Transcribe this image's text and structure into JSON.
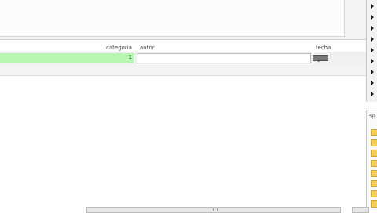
{
  "columns": {
    "categoria": "categoria",
    "autor": "autor",
    "fecha": "fecha"
  },
  "row": {
    "categoria_value": "1",
    "autor_value": ""
  },
  "right_panel": {
    "tab_label": "Sp"
  },
  "colors": {
    "selected_cell": "#b6f5b2",
    "folder": "#f1cf5b"
  },
  "icons": [
    "triangle-right-icon",
    "folder-icon",
    "text-cursor-icon"
  ]
}
